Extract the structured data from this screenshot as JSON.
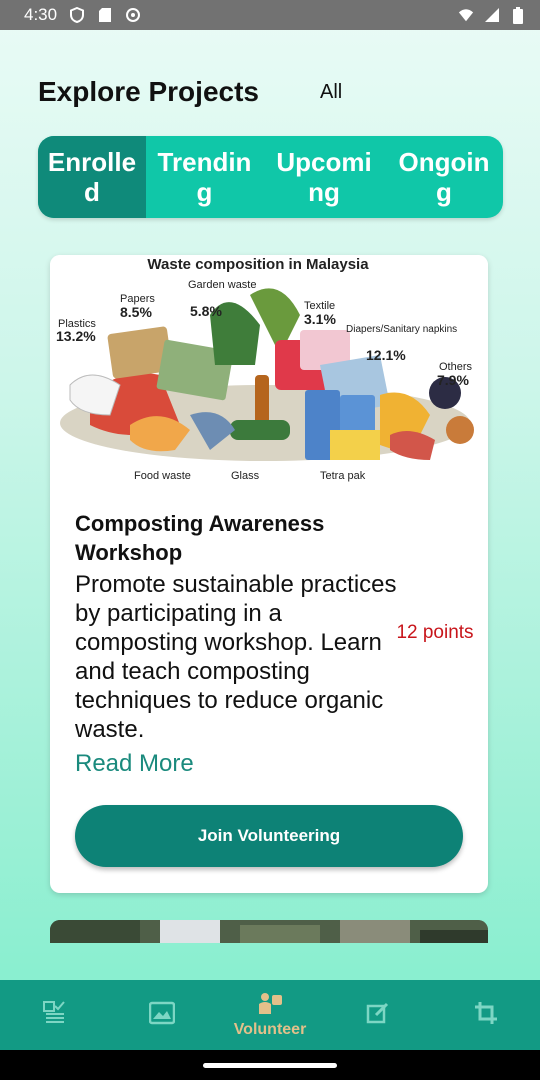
{
  "status_bar": {
    "time": "4:30",
    "icons": [
      "shield-icon",
      "sd-card-icon",
      "sync-icon",
      "wifi-icon",
      "signal-icon",
      "battery-icon"
    ]
  },
  "header": {
    "title": "Explore Projects",
    "filter": "All"
  },
  "tabs": [
    {
      "label": "Enrolled",
      "active": true
    },
    {
      "label": "Trending",
      "active": false
    },
    {
      "label": "Upcoming",
      "active": false
    },
    {
      "label": "Ongoing",
      "active": false
    }
  ],
  "card": {
    "image": {
      "title": "Waste composition in Malaysia",
      "labels": [
        {
          "name": "Plastics",
          "value": "13.2%"
        },
        {
          "name": "Papers",
          "value": "8.5%"
        },
        {
          "name": "Garden waste",
          "value": "5.8%"
        },
        {
          "name": "Textile",
          "value": "3.1%"
        },
        {
          "name": "Diapers/Sanitary napkins",
          "value": "12.1%"
        },
        {
          "name": "Others",
          "value": "7.9%"
        },
        {
          "name": "Food waste",
          "value": ""
        },
        {
          "name": "Glass",
          "value": ""
        },
        {
          "name": "Tetra pak",
          "value": ""
        }
      ]
    },
    "title": "Composting Awareness Workshop",
    "description": "Promote sustainable practices by participating in a composting workshop. Learn and teach composting techniques to reduce organic waste.",
    "points": "12 points",
    "read_more": "Read More",
    "join_label": "Join Volunteering"
  },
  "bottom_nav": [
    {
      "icon": "checklist-icon",
      "label": "",
      "active": false
    },
    {
      "icon": "gallery-icon",
      "label": "",
      "active": false
    },
    {
      "icon": "volunteer-icon",
      "label": "Volunteer",
      "active": true
    },
    {
      "icon": "edit-icon",
      "label": "",
      "active": false
    },
    {
      "icon": "crop-icon",
      "label": "",
      "active": false
    }
  ],
  "colors": {
    "primary": "#0d8276",
    "tab_bar": "#10c7a8",
    "points": "#c8151b",
    "nav_active": "#e3c08a"
  }
}
